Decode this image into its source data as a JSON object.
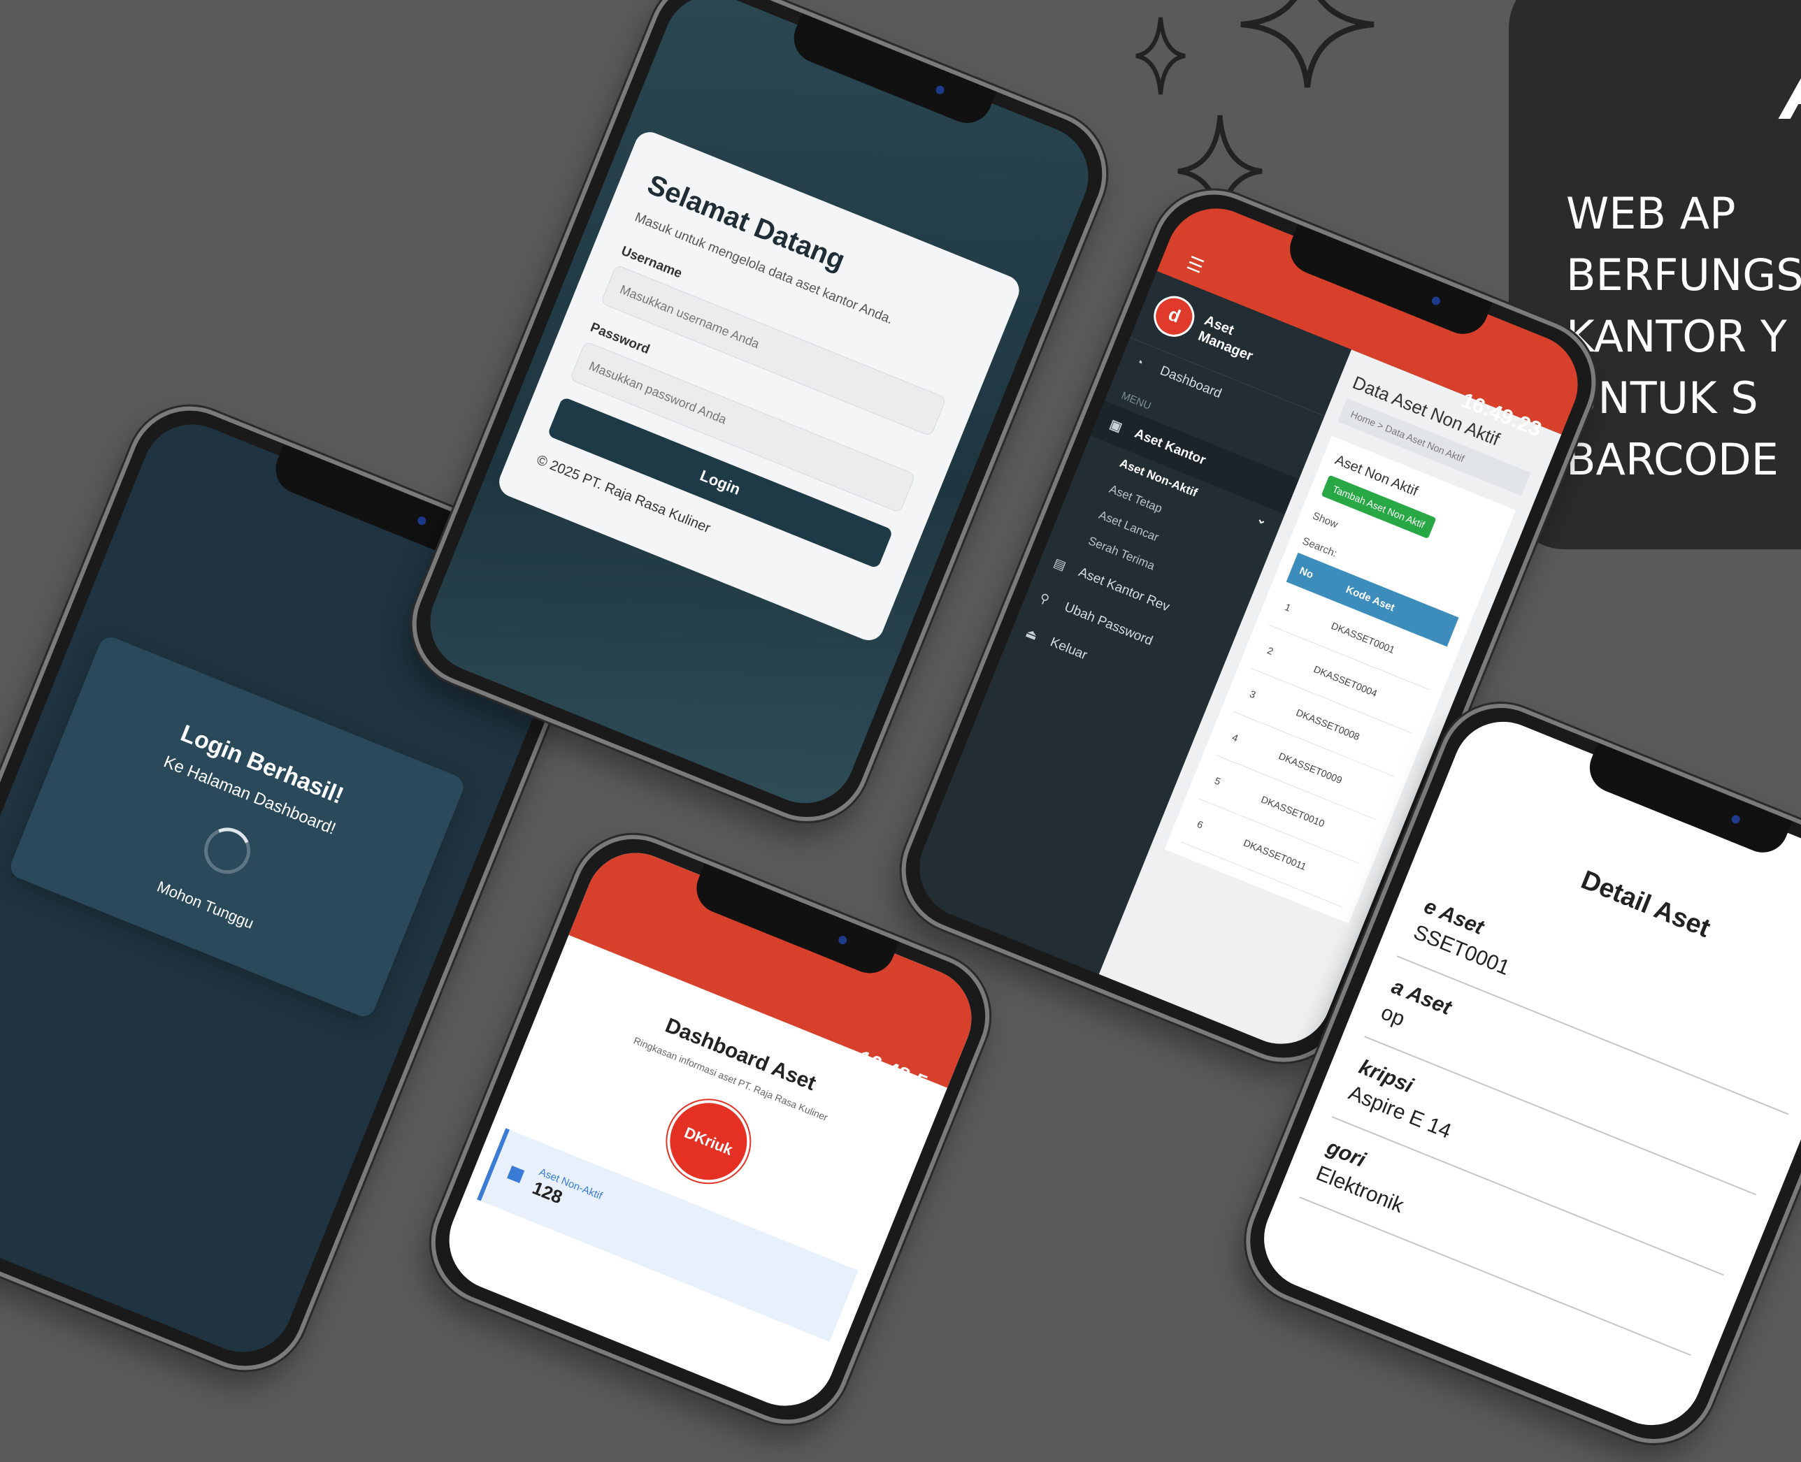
{
  "promo": {
    "letter": "A",
    "lines": [
      "WEB AP",
      "BERFUNGS",
      "KANTOR Y",
      "UNTUK S",
      "BARCODE"
    ]
  },
  "login_success": {
    "title": "Login Berhasil!",
    "subtitle": "Ke Halaman Dashboard!",
    "wait": "Mohon Tunggu"
  },
  "login_form": {
    "title": "Selamat Datang",
    "description": "Masuk untuk mengelola data aset kantor Anda.",
    "username_label": "Username",
    "username_placeholder": "Masukkan username Anda",
    "password_label": "Password",
    "password_placeholder": "Masukkan password Anda",
    "button": "Login",
    "footer": "© 2025 PT. Raja Rasa Kuliner"
  },
  "data_aset": {
    "clock": "16:49:23",
    "brand": "Aset Manager",
    "menu_label": "MENU",
    "sidebar": [
      {
        "icon": "dashboard-icon",
        "label": "Dashboard"
      },
      {
        "icon": "building-icon",
        "label": "Aset Kantor"
      }
    ],
    "submenu_open": "Aset Non-Aktif",
    "submenu": [
      "Aset Tetap",
      "Aset Lancar",
      "Serah Terima"
    ],
    "sidebar_more": [
      "Aset Kantor Rev",
      "Ubah Password",
      "Keluar"
    ],
    "page_title": "Data Aset Non Aktif",
    "breadcrumb": "Home > Data Aset Non Aktif",
    "box_title": "Aset Non Aktif",
    "add_button": "Tambah Aset Non Aktif",
    "show_label": "Show",
    "search_label": "Search:",
    "table_headers": [
      "No",
      "Kode Aset"
    ],
    "rows": [
      {
        "no": "1",
        "kode": "DKASSET0001"
      },
      {
        "no": "2",
        "kode": "DKASSET0004"
      },
      {
        "no": "3",
        "kode": "DKASSET0008"
      },
      {
        "no": "4",
        "kode": "DKASSET0009"
      },
      {
        "no": "5",
        "kode": "DKASSET0010"
      },
      {
        "no": "6",
        "kode": "DKASSET0011"
      }
    ]
  },
  "dashboard": {
    "clock": "16:48:5",
    "title": "Dashboard Aset",
    "subtitle": "Ringkasan informasi aset PT. Raja Rasa Kuliner",
    "logo_text": "DKriuk",
    "stat_label": "Aset Non-Aktif",
    "stat_value": "128"
  },
  "detail": {
    "title": "Detail Aset",
    "fields": [
      {
        "label": "e Aset",
        "value": "SSET0001"
      },
      {
        "label": "a Aset",
        "value": "op"
      },
      {
        "label": "kripsi",
        "value": "Aspire E 14"
      },
      {
        "label": "gori",
        "value": "Elektronik"
      }
    ]
  },
  "colors": {
    "background": "#5a5a5a",
    "panel": "#2b2b2b",
    "brand_red": "#d7402b",
    "sidebar_dark": "#222e33",
    "login_dark": "#1f3a47"
  }
}
